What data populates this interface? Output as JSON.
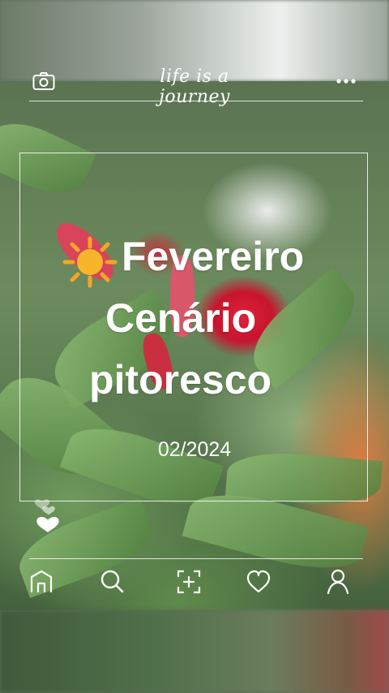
{
  "header": {
    "script_title": "life is a journey"
  },
  "post": {
    "emoji": "☀️",
    "line1": "Fevereiro",
    "line2": "Cenário",
    "line3": "pitoresco",
    "date": "02/2024"
  },
  "icons": {
    "camera": "camera-icon",
    "more": "more-icon",
    "hearts": "hearts-icon",
    "home": "home-icon",
    "search": "search-icon",
    "add": "add-photo-icon",
    "heart": "heart-icon",
    "profile": "profile-icon"
  },
  "colors": {
    "overlay": "#ffffff",
    "sun": "#f5a623"
  }
}
